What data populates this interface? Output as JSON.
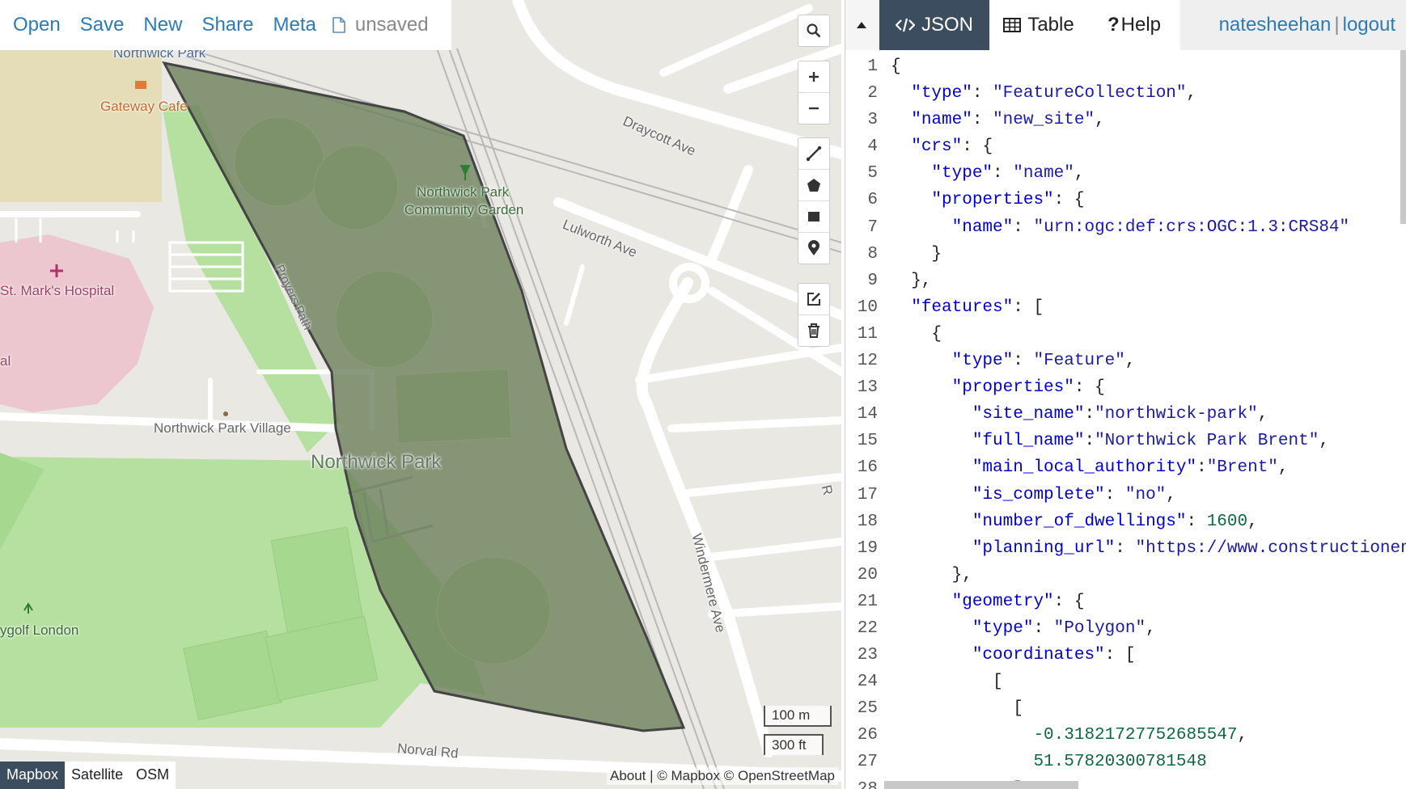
{
  "menu": {
    "items": [
      "Open",
      "Save",
      "New",
      "Share",
      "Meta"
    ],
    "file_status": "unsaved"
  },
  "map": {
    "labels": {
      "northwick_park_station": "Northwick Park",
      "gateway_cafe": "Gateway Cafe",
      "community_garden_1": "Northwick Park",
      "community_garden_2": "Community Garden",
      "draycott_ave": "Draycott Ave",
      "lulworth_ave": "Lulworth Ave",
      "st_marks": "St. Mark's Hospital",
      "hospital_partial": "al",
      "proyers_path": "Proyers Path",
      "northwick_park_village": "Northwick Park Village",
      "northwick_park": "Northwick Park",
      "windermere_ave": "Windermere Ave",
      "norval_rd": "Norval Rd",
      "golf_london": "ygolf London",
      "road_partial": "R"
    },
    "scale_metric": "100 m",
    "scale_imperial": "300 ft",
    "base_layers": [
      "Mapbox",
      "Satellite",
      "OSM"
    ],
    "active_layer": "Mapbox",
    "attribution": "About | © Mapbox © OpenStreetMap",
    "polygon_fill": "#6b7f5a",
    "polygon_stroke": "#444444"
  },
  "controls": {
    "icons": [
      "search-icon",
      "zoom-in-icon",
      "zoom-out-icon",
      "draw-line-icon",
      "draw-polygon-icon",
      "draw-rectangle-icon",
      "draw-marker-icon",
      "edit-icon",
      "trash-icon"
    ]
  },
  "pane": {
    "tabs": [
      {
        "label": "JSON",
        "icon": "code-icon",
        "active": true
      },
      {
        "label": "Table",
        "icon": "table-icon",
        "active": false
      },
      {
        "label": "Help",
        "icon": "question-icon",
        "active": false
      }
    ],
    "user": "natesheehan",
    "logout": "logout"
  },
  "editor": {
    "lines": [
      "{",
      "  \"type\": \"FeatureCollection\",",
      "  \"name\": \"new_site\",",
      "  \"crs\": {",
      "    \"type\": \"name\",",
      "    \"properties\": {",
      "      \"name\": \"urn:ogc:def:crs:OGC:1.3:CRS84\"",
      "    }",
      "  },",
      "  \"features\": [",
      "    {",
      "      \"type\": \"Feature\",",
      "      \"properties\": {",
      "        \"site_name\":\"northwick-park\",",
      "        \"full_name\":\"Northwick Park Brent\",",
      "        \"main_local_authority\":\"Brent\",",
      "        \"is_complete\": \"no\",",
      "        \"number_of_dwellings\": 1600,",
      "        \"planning_url\": \"https://www.constructionenq",
      "      },",
      "      \"geometry\": {",
      "        \"type\": \"Polygon\",",
      "        \"coordinates\": [",
      "          [",
      "            [",
      "              -0.31821727752685547,",
      "              51.57820300781548",
      "            ]"
    ]
  }
}
